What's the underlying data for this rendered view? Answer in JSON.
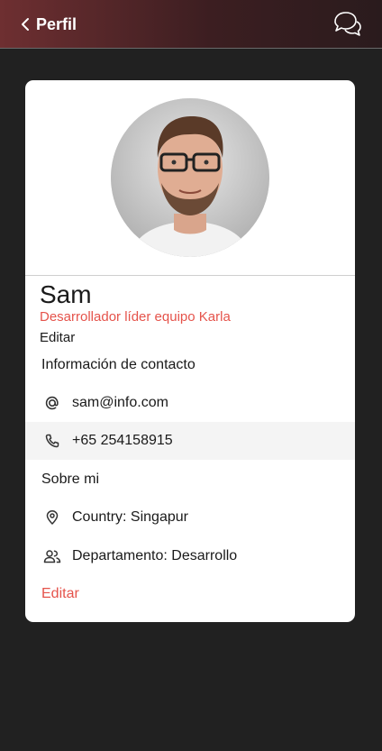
{
  "header": {
    "back_label": "Perfil",
    "chat_icon": "chat-bubbles-icon"
  },
  "profile": {
    "name": "Sam",
    "role": "Desarrollador líder equipo Karla",
    "edit_label": "Editar"
  },
  "contact": {
    "section_title": "Información de contacto",
    "email": "sam@info.com",
    "phone": "+65 254158915"
  },
  "about": {
    "section_title": "Sobre mi",
    "country": "Country: Singapur",
    "department": "Departamento: Desarrollo"
  },
  "footer": {
    "edit_label": "Editar"
  },
  "colors": {
    "accent": "#e5534b",
    "background": "#212121",
    "header_start": "#6e2f31"
  }
}
